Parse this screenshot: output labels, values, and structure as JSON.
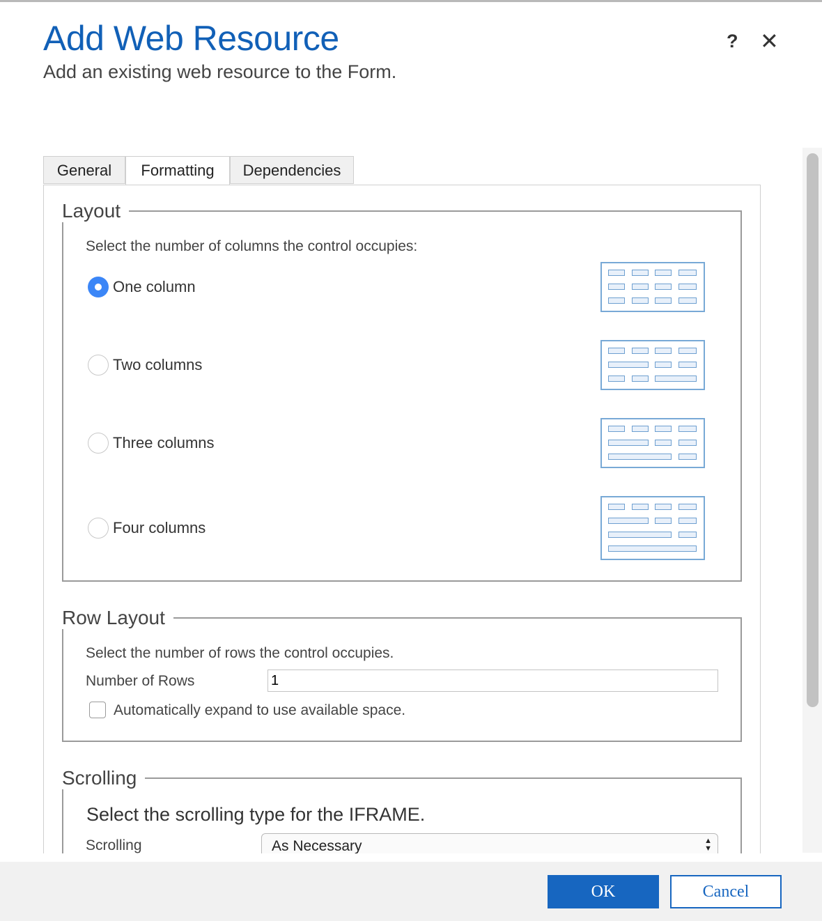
{
  "dialog": {
    "title": "Add Web Resource",
    "subtitle": "Add an existing web resource to the Form.",
    "help_label": "?",
    "close_label": "✕"
  },
  "tabs": [
    {
      "label": "General",
      "active": false
    },
    {
      "label": "Formatting",
      "active": true
    },
    {
      "label": "Dependencies",
      "active": false
    }
  ],
  "layout": {
    "legend": "Layout",
    "description": "Select the number of columns the control occupies:",
    "options": [
      {
        "label": "One column",
        "checked": true
      },
      {
        "label": "Two columns",
        "checked": false
      },
      {
        "label": "Three columns",
        "checked": false
      },
      {
        "label": "Four columns",
        "checked": false
      }
    ]
  },
  "row_layout": {
    "legend": "Row Layout",
    "description": "Select the number of rows the control occupies.",
    "rows_label": "Number of Rows",
    "rows_value": "1",
    "auto_expand_label": "Automatically expand to use available space.",
    "auto_expand_checked": false
  },
  "scrolling": {
    "legend": "Scrolling",
    "description": "Select the scrolling type for the IFRAME.",
    "field_label": "Scrolling",
    "selected": "As Necessary"
  },
  "footer": {
    "ok_label": "OK",
    "cancel_label": "Cancel"
  },
  "colors": {
    "title": "#1160b7",
    "primary_button": "#1766c0",
    "radio_checked": "#3b86f7",
    "preview_border": "#78a9d6"
  }
}
